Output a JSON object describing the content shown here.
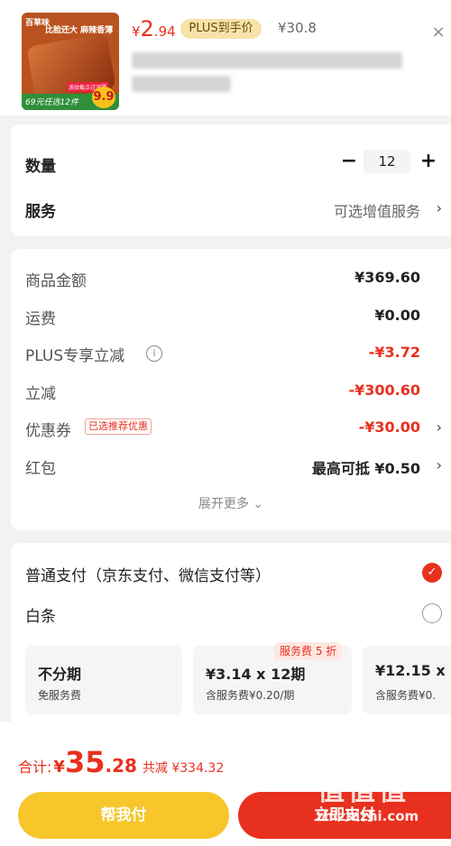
{
  "product": {
    "brand": "百草味",
    "slogan": "比脸还大 麻辣香薄",
    "promo": "69元任选12件",
    "badge_price": "9.9",
    "tiny_text": "波纹截点过深薄"
  },
  "price": {
    "symbol": "¥",
    "integer": "2",
    "decimal": ".94"
  },
  "plus_tag": "PLUS到手价",
  "original_price": "¥30.8",
  "close_icon": "×",
  "quantity": {
    "label": "数量",
    "value": "12",
    "minus": "−",
    "plus": "+"
  },
  "service": {
    "label": "服务",
    "value": "可选增值服务"
  },
  "summary": {
    "items": [
      {
        "label": "商品金额",
        "value": "¥369.60"
      },
      {
        "label": "运费",
        "value": "¥0.00"
      },
      {
        "label": "PLUS专享立减",
        "value": "-¥3.72"
      },
      {
        "label": "立减",
        "value": "-¥300.60"
      },
      {
        "label": "优惠券",
        "value": "-¥30.00",
        "tag": "已选推荐优惠"
      },
      {
        "label": "红包",
        "value": "最高可抵 ¥0.50"
      }
    ],
    "expand": "展开更多 ⌄"
  },
  "payment": {
    "normal": "普通支付（京东支付、微信支付等）",
    "baitiao": "白条",
    "badge": "服务费 5 折",
    "installments": [
      {
        "title": "不分期",
        "sub": "免服务费"
      },
      {
        "title": "¥3.14 x 12期",
        "sub": "含服务费¥0.20/期"
      },
      {
        "title": "¥12.15 x",
        "sub": "含服务费¥0."
      }
    ]
  },
  "total": {
    "label": "合计:",
    "symbol": "¥",
    "integer": "35",
    "decimal": ".28",
    "discount": "共减 ¥334.32"
  },
  "buttons": {
    "help_pay": "帮我付",
    "pay": "立即支付"
  },
  "watermark": {
    "logo": "值值值",
    "url": "zhizhizhi.com"
  },
  "colors": {
    "accent": "#e8301e",
    "yellow": "#f6c62a",
    "plus_tag_bg": "#f6e3a9"
  }
}
